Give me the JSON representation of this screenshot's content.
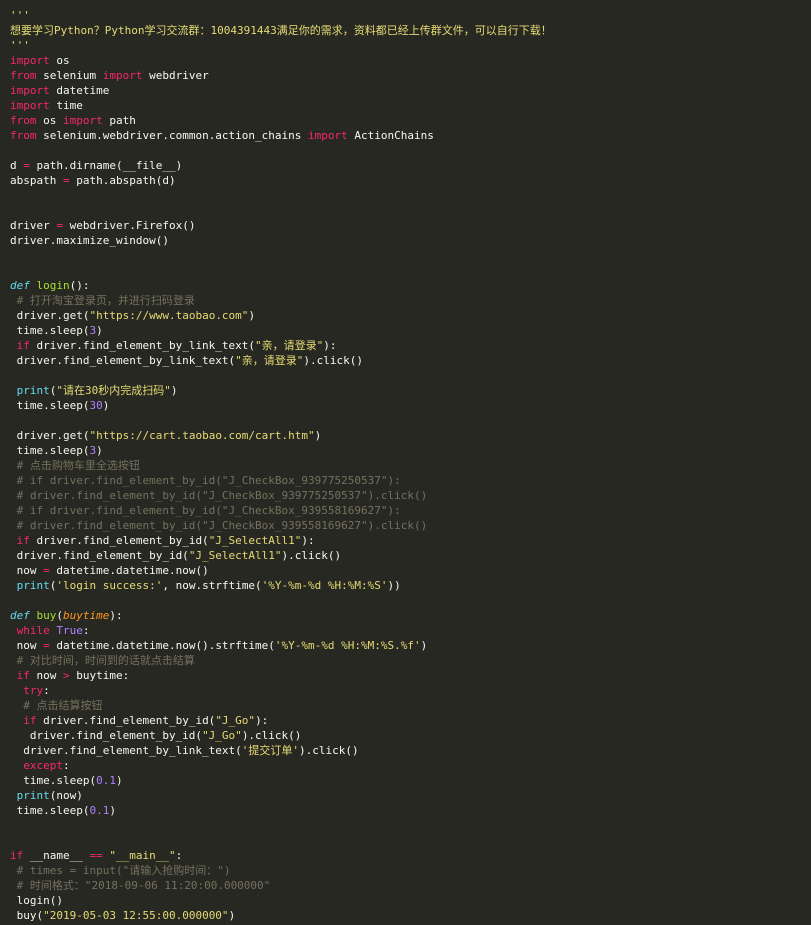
{
  "editor": {
    "colors": {
      "background": "#272822",
      "text": "#F8F8F2",
      "keyword": "#F92672",
      "definition": "#66D9EF",
      "function": "#A6E22E",
      "builtin": "#66D9EF",
      "string": "#E6DB74",
      "number": "#AE81FF",
      "comment": "#75715E",
      "parameter": "#FD971F"
    },
    "lines": [
      [
        [
          "'''",
          "str"
        ]
      ],
      [
        [
          "想要学习Python？Python学习交流群：1004391443满足你的需求，资料都已经上传群文件，可以自行下载！",
          "str"
        ]
      ],
      [
        [
          "'''",
          "str"
        ]
      ],
      [
        [
          "import",
          "kw"
        ],
        [
          " os",
          "plain"
        ]
      ],
      [
        [
          "from",
          "kw"
        ],
        [
          " selenium ",
          "plain"
        ],
        [
          "import",
          "kw"
        ],
        [
          " webdriver",
          "plain"
        ]
      ],
      [
        [
          "import",
          "kw"
        ],
        [
          " datetime",
          "plain"
        ]
      ],
      [
        [
          "import",
          "kw"
        ],
        [
          " time",
          "plain"
        ]
      ],
      [
        [
          "from",
          "kw"
        ],
        [
          " os ",
          "plain"
        ],
        [
          "import",
          "kw"
        ],
        [
          " path",
          "plain"
        ]
      ],
      [
        [
          "from",
          "kw"
        ],
        [
          " selenium.webdriver.common.action_chains ",
          "plain"
        ],
        [
          "import",
          "kw"
        ],
        [
          " ActionChains",
          "plain"
        ]
      ],
      [],
      [
        [
          "d ",
          "plain"
        ],
        [
          "=",
          "kw"
        ],
        [
          " path.dirname(__file__)",
          "plain"
        ]
      ],
      [
        [
          "abspath ",
          "plain"
        ],
        [
          "=",
          "kw"
        ],
        [
          " path.abspath(d)",
          "plain"
        ]
      ],
      [],
      [],
      [
        [
          "driver ",
          "plain"
        ],
        [
          "=",
          "kw"
        ],
        [
          " webdriver.Firefox()",
          "plain"
        ]
      ],
      [
        [
          "driver.maximize_window()",
          "plain"
        ]
      ],
      [],
      [],
      [
        [
          "def",
          "def"
        ],
        [
          " ",
          "plain"
        ],
        [
          "login",
          "fn"
        ],
        [
          "():",
          "plain"
        ]
      ],
      [
        [
          " # 打开淘宝登录页，并进行扫码登录",
          "cmt"
        ]
      ],
      [
        [
          " driver.get(",
          "plain"
        ],
        [
          "\"https://www.taobao.com\"",
          "str"
        ],
        [
          ")",
          "plain"
        ]
      ],
      [
        [
          " time.sleep(",
          "plain"
        ],
        [
          "3",
          "num"
        ],
        [
          ")",
          "plain"
        ]
      ],
      [
        [
          " ",
          "plain"
        ],
        [
          "if",
          "kw"
        ],
        [
          " driver.find_element_by_link_text(",
          "plain"
        ],
        [
          "\"亲，请登录\"",
          "str"
        ],
        [
          "):",
          "plain"
        ]
      ],
      [
        [
          " driver.find_element_by_link_text(",
          "plain"
        ],
        [
          "\"亲，请登录\"",
          "str"
        ],
        [
          ").click()",
          "plain"
        ]
      ],
      [],
      [
        [
          " ",
          "plain"
        ],
        [
          "print",
          "bi"
        ],
        [
          "(",
          "plain"
        ],
        [
          "\"请在30秒内完成扫码\"",
          "str"
        ],
        [
          ")",
          "plain"
        ]
      ],
      [
        [
          " time.sleep(",
          "plain"
        ],
        [
          "30",
          "num"
        ],
        [
          ")",
          "plain"
        ]
      ],
      [],
      [
        [
          " driver.get(",
          "plain"
        ],
        [
          "\"https://cart.taobao.com/cart.htm\"",
          "str"
        ],
        [
          ")",
          "plain"
        ]
      ],
      [
        [
          " time.sleep(",
          "plain"
        ],
        [
          "3",
          "num"
        ],
        [
          ")",
          "plain"
        ]
      ],
      [
        [
          " # 点击购物车里全选按钮",
          "cmt"
        ]
      ],
      [
        [
          " # if driver.find_element_by_id(\"J_CheckBox_939775250537\"):",
          "cmt"
        ]
      ],
      [
        [
          " # driver.find_element_by_id(\"J_CheckBox_939775250537\").click()",
          "cmt"
        ]
      ],
      [
        [
          " # if driver.find_element_by_id(\"J_CheckBox_939558169627\"):",
          "cmt"
        ]
      ],
      [
        [
          " # driver.find_element_by_id(\"J_CheckBox_939558169627\").click()",
          "cmt"
        ]
      ],
      [
        [
          " ",
          "plain"
        ],
        [
          "if",
          "kw"
        ],
        [
          " driver.find_element_by_id(",
          "plain"
        ],
        [
          "\"J_SelectAll1\"",
          "str"
        ],
        [
          "):",
          "plain"
        ]
      ],
      [
        [
          " driver.find_element_by_id(",
          "plain"
        ],
        [
          "\"J_SelectAll1\"",
          "str"
        ],
        [
          ").click()",
          "plain"
        ]
      ],
      [
        [
          " now ",
          "plain"
        ],
        [
          "=",
          "kw"
        ],
        [
          " datetime.datetime.now()",
          "plain"
        ]
      ],
      [
        [
          " ",
          "plain"
        ],
        [
          "print",
          "bi"
        ],
        [
          "(",
          "plain"
        ],
        [
          "'login success:'",
          "str"
        ],
        [
          ", now.strftime(",
          "plain"
        ],
        [
          "'%Y-%m-%d %H:%M:%S'",
          "str"
        ],
        [
          "))",
          "plain"
        ]
      ],
      [],
      [
        [
          "def",
          "def"
        ],
        [
          " ",
          "plain"
        ],
        [
          "buy",
          "fn"
        ],
        [
          "(",
          "plain"
        ],
        [
          "buytime",
          "param"
        ],
        [
          "):",
          "plain"
        ]
      ],
      [
        [
          " ",
          "plain"
        ],
        [
          "while",
          "kw"
        ],
        [
          " ",
          "plain"
        ],
        [
          "True",
          "num"
        ],
        [
          ":",
          "plain"
        ]
      ],
      [
        [
          " now ",
          "plain"
        ],
        [
          "=",
          "kw"
        ],
        [
          " datetime.datetime.now().strftime(",
          "plain"
        ],
        [
          "'%Y-%m-%d %H:%M:%S.%f'",
          "str"
        ],
        [
          ")",
          "plain"
        ]
      ],
      [
        [
          " # 对比时间，时间到的话就点击结算",
          "cmt"
        ]
      ],
      [
        [
          " ",
          "plain"
        ],
        [
          "if",
          "kw"
        ],
        [
          " now ",
          "plain"
        ],
        [
          ">",
          "kw"
        ],
        [
          " buytime:",
          "plain"
        ]
      ],
      [
        [
          "  ",
          "plain"
        ],
        [
          "try",
          "kw"
        ],
        [
          ":",
          "plain"
        ]
      ],
      [
        [
          "  # 点击结算按钮",
          "cmt"
        ]
      ],
      [
        [
          "  ",
          "plain"
        ],
        [
          "if",
          "kw"
        ],
        [
          " driver.find_element_by_id(",
          "plain"
        ],
        [
          "\"J_Go\"",
          "str"
        ],
        [
          "):",
          "plain"
        ]
      ],
      [
        [
          "   driver.find_element_by_id(",
          "plain"
        ],
        [
          "\"J_Go\"",
          "str"
        ],
        [
          ").click()",
          "plain"
        ]
      ],
      [
        [
          "  driver.find_element_by_link_text(",
          "plain"
        ],
        [
          "'提交订单'",
          "str"
        ],
        [
          ").click()",
          "plain"
        ]
      ],
      [
        [
          "  ",
          "plain"
        ],
        [
          "except",
          "kw"
        ],
        [
          ":",
          "plain"
        ]
      ],
      [
        [
          "  time.sleep(",
          "plain"
        ],
        [
          "0.1",
          "num"
        ],
        [
          ")",
          "plain"
        ]
      ],
      [
        [
          " ",
          "plain"
        ],
        [
          "print",
          "bi"
        ],
        [
          "(now)",
          "plain"
        ]
      ],
      [
        [
          " time.sleep(",
          "plain"
        ],
        [
          "0.1",
          "num"
        ],
        [
          ")",
          "plain"
        ]
      ],
      [],
      [],
      [
        [
          "if",
          "kw"
        ],
        [
          " __name__ ",
          "plain"
        ],
        [
          "==",
          "kw"
        ],
        [
          " ",
          "plain"
        ],
        [
          "\"__main__\"",
          "str"
        ],
        [
          ":",
          "plain"
        ]
      ],
      [
        [
          " # times = input(\"请输入抢购时间：\")",
          "cmt"
        ]
      ],
      [
        [
          " # 时间格式：\"2018-09-06 11:20:00.000000\"",
          "cmt"
        ]
      ],
      [
        [
          " login()",
          "plain"
        ]
      ],
      [
        [
          " buy(",
          "plain"
        ],
        [
          "\"2019-05-03 12:55:00.000000\"",
          "str"
        ],
        [
          ")",
          "plain"
        ]
      ]
    ]
  }
}
